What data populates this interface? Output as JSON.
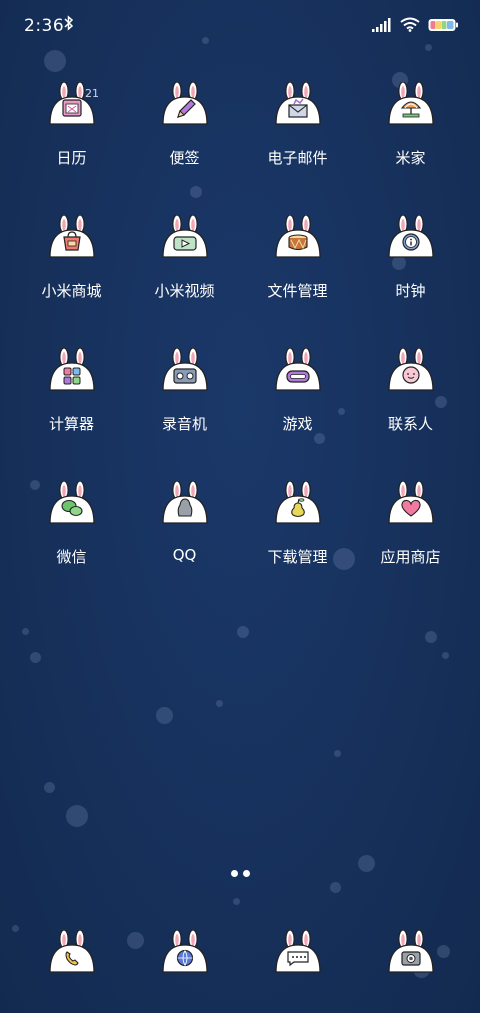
{
  "status_bar": {
    "time": "2:36",
    "bluetooth_icon": "bluetooth-icon",
    "signal_icon": "cellular-signal-icon",
    "wifi_icon": "wifi-icon",
    "battery_icon": "battery-rainbow-icon"
  },
  "apps": [
    [
      {
        "label": "日历",
        "icon": "calendar-icon",
        "badge": "21"
      },
      {
        "label": "便签",
        "icon": "pencil-icon"
      },
      {
        "label": "电子邮件",
        "icon": "envelope-icon"
      },
      {
        "label": "米家",
        "icon": "umbrella-icon"
      }
    ],
    [
      {
        "label": "小米商城",
        "icon": "shopping-bag-icon"
      },
      {
        "label": "小米视频",
        "icon": "video-play-icon"
      },
      {
        "label": "文件管理",
        "icon": "drum-icon"
      },
      {
        "label": "时钟",
        "icon": "info-clock-icon"
      }
    ],
    [
      {
        "label": "计算器",
        "icon": "calculator-grid-icon"
      },
      {
        "label": "录音机",
        "icon": "cassette-icon"
      },
      {
        "label": "游戏",
        "icon": "gamepad-icon"
      },
      {
        "label": "联系人",
        "icon": "smiley-face-icon"
      }
    ],
    [
      {
        "label": "微信",
        "icon": "wechat-bubbles-icon"
      },
      {
        "label": "QQ",
        "icon": "penguin-icon"
      },
      {
        "label": "下载管理",
        "icon": "pear-icon"
      },
      {
        "label": "应用商店",
        "icon": "heart-icon"
      }
    ]
  ],
  "dock": [
    {
      "name": "phone",
      "icon": "phone-icon"
    },
    {
      "name": "browser",
      "icon": "globe-icon"
    },
    {
      "name": "messages",
      "icon": "chat-bubble-icon"
    },
    {
      "name": "camera",
      "icon": "camera-icon"
    }
  ],
  "page_indicator": {
    "pages": 2,
    "current": 1
  },
  "colors": {
    "background": "#16305a",
    "icon_face": "#ffffff",
    "ear_pink": "#f2a7b8",
    "text": "#ffffff"
  }
}
